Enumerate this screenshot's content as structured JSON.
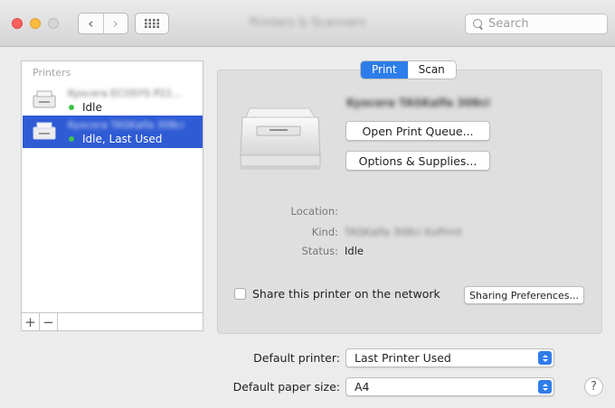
{
  "window": {
    "title": "Printers & Scanners"
  },
  "toolbar": {
    "back": "‹",
    "forward": "›",
    "search_placeholder": "Search"
  },
  "printers": {
    "header": "Printers",
    "items": [
      {
        "name": "Kyocera ECOSYS P21...",
        "status": "Idle"
      },
      {
        "name": "Kyocera TASKalfa 308ci",
        "status": "Idle, Last Used"
      }
    ],
    "add": "+",
    "remove": "−"
  },
  "tabs": {
    "print": "Print",
    "scan": "Scan"
  },
  "detail": {
    "printer_name": "Kyocera TASKalfa 308ci",
    "open_queue": "Open Print Queue...",
    "options": "Options & Supplies...",
    "location_label": "Location:",
    "location_value": "",
    "kind_label": "Kind:",
    "kind_value": "TASKalfa 308ci KxPrint",
    "status_label": "Status:",
    "status_value": "Idle",
    "share_label": "Share this printer on the network",
    "share_checked": false,
    "sharing_prefs": "Sharing Preferences..."
  },
  "defaults": {
    "printer_label": "Default printer:",
    "printer_value": "Last Printer Used",
    "paper_label": "Default paper size:",
    "paper_value": "A4",
    "help": "?"
  },
  "colors": {
    "accent": "#2d7dea",
    "selection": "#2f5bd5",
    "status_dot": "#3fc24a"
  }
}
